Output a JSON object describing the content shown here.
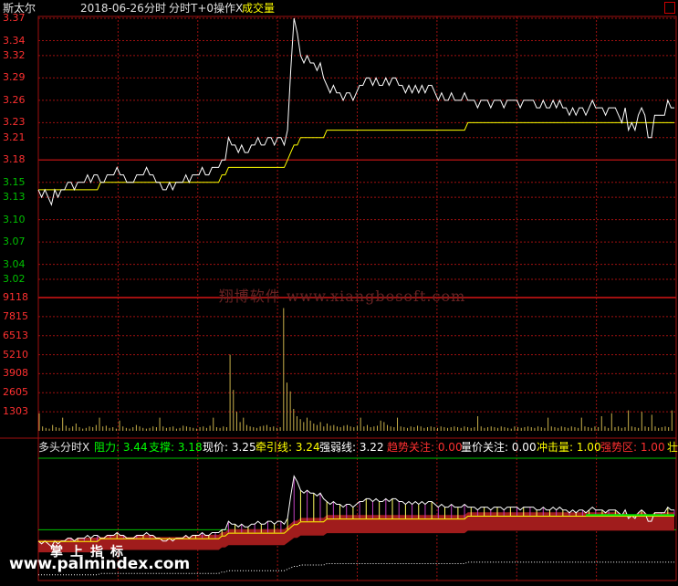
{
  "header": {
    "stock": "斯太尔",
    "date": "2018-06-26",
    "mode": "分时",
    "indicator": "分时T+0操作X",
    "volume_label": "成交量"
  },
  "indicator_bar": {
    "name": "多头分时X",
    "resist_label": "阻力: 3.44",
    "support_label": "支撑: 3.18",
    "price_label": "现价: 3.25",
    "pull_label": "牵引线: 3.24",
    "weak_label": "强弱线: 3.22",
    "trend_label": "趋势关注: 0.00",
    "volprice_label": "量价关注: 0.00",
    "impact_label": "冲击量: 1.00",
    "strong_label": "强势区: 1.00",
    "extra": "壮"
  },
  "watermark": "翔博软件 www.xiangbosoft.com",
  "watermark2": "www.palmindex.com",
  "logo_text": "掌上指标",
  "colors": {
    "bg": "#000000",
    "grid": "#a01010",
    "price_line": "#ffffff",
    "avg_line": "#ffff00",
    "volume_bar": "#c8b04a",
    "up_text": "#ff3030",
    "down_text": "#00c000"
  },
  "chart_data": [
    {
      "type": "line",
      "y_ticks": [
        "3.37",
        "3.34",
        "3.32",
        "3.29",
        "3.26",
        "3.23",
        "3.21",
        "3.18",
        "3.15",
        "3.13",
        "3.10",
        "3.07",
        "3.04",
        "3.02"
      ],
      "ylim": [
        3.02,
        3.37
      ],
      "reference_price": 3.18,
      "series": [
        {
          "values": [
            3.14,
            3.13,
            3.14,
            3.13,
            3.12,
            3.14,
            3.13,
            3.14,
            3.14,
            3.15,
            3.15,
            3.14,
            3.15,
            3.15,
            3.15,
            3.16,
            3.15,
            3.16,
            3.16,
            3.15,
            3.15,
            3.16,
            3.16,
            3.16,
            3.17,
            3.16,
            3.16,
            3.15,
            3.15,
            3.15,
            3.16,
            3.16,
            3.16,
            3.17,
            3.16,
            3.16,
            3.15,
            3.15,
            3.14,
            3.14,
            3.15,
            3.14,
            3.15,
            3.15,
            3.15,
            3.16,
            3.15,
            3.16,
            3.16,
            3.16,
            3.17,
            3.16,
            3.16,
            3.17,
            3.17,
            3.17,
            3.18,
            3.18,
            3.21,
            3.2,
            3.2,
            3.19,
            3.2,
            3.19,
            3.19,
            3.2,
            3.2,
            3.21,
            3.2,
            3.2,
            3.21,
            3.21,
            3.2,
            3.21,
            3.21,
            3.2,
            3.22,
            3.3,
            3.37,
            3.35,
            3.32,
            3.31,
            3.32,
            3.31,
            3.31,
            3.3,
            3.31,
            3.29,
            3.28,
            3.27,
            3.28,
            3.27,
            3.27,
            3.26,
            3.27,
            3.27,
            3.26,
            3.27,
            3.28,
            3.28,
            3.29,
            3.29,
            3.28,
            3.29,
            3.28,
            3.28,
            3.29,
            3.28,
            3.29,
            3.29,
            3.28,
            3.28,
            3.27,
            3.28,
            3.27,
            3.28,
            3.27,
            3.28,
            3.27,
            3.28,
            3.28,
            3.27,
            3.26,
            3.27,
            3.26,
            3.26,
            3.27,
            3.26,
            3.26,
            3.26,
            3.27,
            3.26,
            3.26,
            3.26,
            3.25,
            3.26,
            3.26,
            3.26,
            3.25,
            3.26,
            3.26,
            3.26,
            3.25,
            3.26,
            3.26,
            3.26,
            3.26,
            3.25,
            3.26,
            3.26,
            3.26,
            3.26,
            3.25,
            3.25,
            3.26,
            3.25,
            3.25,
            3.26,
            3.25,
            3.26,
            3.25,
            3.25,
            3.24,
            3.25,
            3.24,
            3.25,
            3.25,
            3.24,
            3.25,
            3.26,
            3.25,
            3.25,
            3.25,
            3.24,
            3.25,
            3.25,
            3.25,
            3.24,
            3.23,
            3.25,
            3.22,
            3.23,
            3.22,
            3.24,
            3.25,
            3.24,
            3.21,
            3.21,
            3.24,
            3.24,
            3.24,
            3.24,
            3.26,
            3.25,
            3.25
          ]
        },
        {
          "values": [
            3.14,
            3.14,
            3.14,
            3.14,
            3.14,
            3.14,
            3.14,
            3.14,
            3.14,
            3.14,
            3.14,
            3.14,
            3.14,
            3.14,
            3.14,
            3.14,
            3.14,
            3.14,
            3.14,
            3.15,
            3.15,
            3.15,
            3.15,
            3.15,
            3.15,
            3.15,
            3.15,
            3.15,
            3.15,
            3.15,
            3.15,
            3.15,
            3.15,
            3.15,
            3.15,
            3.15,
            3.15,
            3.15,
            3.15,
            3.15,
            3.15,
            3.15,
            3.15,
            3.15,
            3.15,
            3.15,
            3.15,
            3.15,
            3.15,
            3.15,
            3.15,
            3.15,
            3.15,
            3.15,
            3.15,
            3.15,
            3.16,
            3.16,
            3.17,
            3.17,
            3.17,
            3.17,
            3.17,
            3.17,
            3.17,
            3.17,
            3.17,
            3.17,
            3.17,
            3.17,
            3.17,
            3.17,
            3.17,
            3.17,
            3.17,
            3.17,
            3.18,
            3.19,
            3.2,
            3.2,
            3.21,
            3.21,
            3.21,
            3.21,
            3.21,
            3.21,
            3.21,
            3.21,
            3.22,
            3.22,
            3.22,
            3.22,
            3.22,
            3.22,
            3.22,
            3.22,
            3.22,
            3.22,
            3.22,
            3.22,
            3.22,
            3.22,
            3.22,
            3.22,
            3.22,
            3.22,
            3.22,
            3.22,
            3.22,
            3.22,
            3.22,
            3.22,
            3.22,
            3.22,
            3.22,
            3.22,
            3.22,
            3.22,
            3.22,
            3.22,
            3.22,
            3.22,
            3.22,
            3.22,
            3.22,
            3.22,
            3.22,
            3.22,
            3.22,
            3.22,
            3.22,
            3.23,
            3.23,
            3.23,
            3.23,
            3.23,
            3.23,
            3.23,
            3.23,
            3.23,
            3.23,
            3.23,
            3.23,
            3.23,
            3.23,
            3.23,
            3.23,
            3.23,
            3.23,
            3.23,
            3.23,
            3.23,
            3.23,
            3.23,
            3.23,
            3.23,
            3.23,
            3.23,
            3.23,
            3.23,
            3.23,
            3.23,
            3.23,
            3.23,
            3.23,
            3.23,
            3.23,
            3.23,
            3.23,
            3.23,
            3.23,
            3.23,
            3.23,
            3.23,
            3.23,
            3.23,
            3.23,
            3.23,
            3.23,
            3.23,
            3.23,
            3.23,
            3.23,
            3.23,
            3.23,
            3.23,
            3.23,
            3.23,
            3.23,
            3.23,
            3.23,
            3.23,
            3.23,
            3.23,
            3.23
          ]
        }
      ]
    },
    {
      "type": "bar",
      "y_ticks": [
        "9118",
        "7815",
        "6513",
        "5210",
        "3908",
        "2605",
        "1303"
      ],
      "ylim": [
        0,
        9118
      ],
      "values": [
        1200,
        300,
        200,
        150,
        400,
        250,
        200,
        900,
        350,
        200,
        300,
        500,
        250,
        150,
        200,
        300,
        250,
        400,
        900,
        300,
        350,
        200,
        250,
        150,
        700,
        300,
        200,
        150,
        250,
        400,
        300,
        200,
        150,
        200,
        300,
        250,
        900,
        300,
        200,
        250,
        300,
        150,
        200,
        350,
        300,
        250,
        200,
        150,
        250,
        300,
        200,
        350,
        900,
        250,
        200,
        300,
        250,
        5210,
        2800,
        1300,
        600,
        900,
        400,
        300,
        250,
        200,
        300,
        350,
        400,
        250,
        300,
        200,
        250,
        8400,
        3300,
        2700,
        1500,
        1000,
        800,
        600,
        900,
        700,
        500,
        400,
        600,
        300,
        500,
        350,
        400,
        300,
        250,
        350,
        400,
        300,
        250,
        350,
        900,
        300,
        400,
        250,
        300,
        350,
        700,
        600,
        400,
        300,
        250,
        900,
        300,
        250,
        200,
        300,
        250,
        350,
        300,
        200,
        250,
        300,
        250,
        200,
        300,
        250,
        200,
        250,
        300,
        250,
        200,
        300,
        250,
        200,
        250,
        1000,
        300,
        200,
        250,
        300,
        250,
        200,
        300,
        250,
        200,
        150,
        300,
        250,
        200,
        250,
        300,
        250,
        200,
        300,
        250,
        200,
        900,
        300,
        250,
        200,
        300,
        250,
        200,
        300,
        250,
        200,
        900,
        300,
        250,
        200,
        300,
        250,
        1000,
        300,
        200,
        1200,
        250,
        300,
        200,
        250,
        1400,
        300,
        250,
        200,
        1300,
        300,
        250,
        1100,
        300,
        200,
        250,
        300,
        250,
        1400
      ]
    }
  ]
}
